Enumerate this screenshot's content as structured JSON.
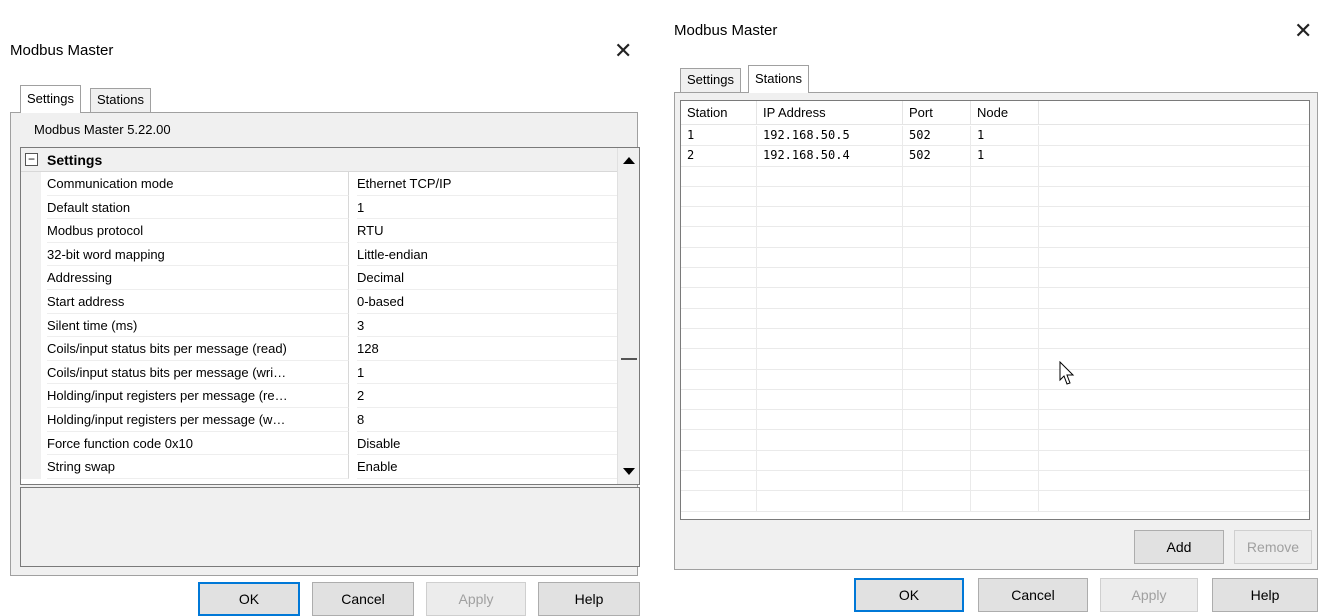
{
  "left_window": {
    "title": "Modbus Master",
    "tabs": [
      {
        "label": "Settings"
      },
      {
        "label": "Stations"
      }
    ],
    "version": "Modbus Master 5.22.00",
    "group_label": "Settings",
    "group_toggle": "⊟",
    "properties": [
      {
        "name": "Communication mode",
        "value": "Ethernet TCP/IP"
      },
      {
        "name": "Default station",
        "value": "1"
      },
      {
        "name": "Modbus protocol",
        "value": "RTU"
      },
      {
        "name": "32-bit word mapping",
        "value": "Little-endian"
      },
      {
        "name": "Addressing",
        "value": "Decimal"
      },
      {
        "name": "Start address",
        "value": "0-based"
      },
      {
        "name": "Silent time (ms)",
        "value": "3"
      },
      {
        "name": "Coils/input status bits per message (read)",
        "value": "128"
      },
      {
        "name": "Coils/input status bits per message (wri…",
        "value": "1"
      },
      {
        "name": "Holding/input registers per message (re…",
        "value": "2"
      },
      {
        "name": "Holding/input registers per message (w…",
        "value": "8"
      },
      {
        "name": "Force function code 0x10",
        "value": "Disable"
      },
      {
        "name": "String swap",
        "value": "Enable"
      }
    ],
    "buttons": {
      "ok": "OK",
      "cancel": "Cancel",
      "apply": "Apply",
      "help": "Help"
    }
  },
  "right_window": {
    "title": "Modbus Master",
    "tabs": [
      {
        "label": "Settings"
      },
      {
        "label": "Stations"
      }
    ],
    "columns": [
      "Station",
      "IP Address",
      "Port",
      "Node"
    ],
    "rows": [
      {
        "station": "1",
        "ip": "192.168.50.5",
        "port": "502",
        "node": "1"
      },
      {
        "station": "2",
        "ip": "192.168.50.4",
        "port": "502",
        "node": "1"
      }
    ],
    "add_label": "Add",
    "remove_label": "Remove",
    "buttons": {
      "ok": "OK",
      "cancel": "Cancel",
      "apply": "Apply",
      "help": "Help"
    }
  },
  "icons": {
    "close": "close-icon",
    "cursor": "mouse-pointer-icon"
  },
  "close_glyph": "✕",
  "colors": {
    "dialog_bg": "#f0f0f0",
    "focus_border": "#0078d7",
    "disabled_text": "#a0a0a0"
  }
}
